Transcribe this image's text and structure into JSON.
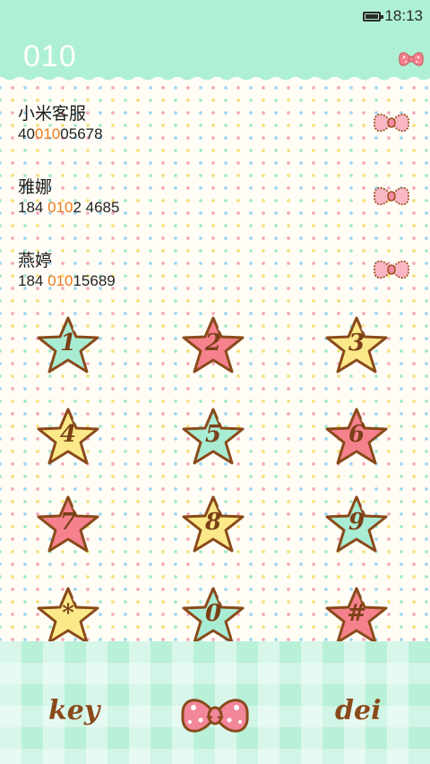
{
  "status_bar": {
    "time": "18:13",
    "battery_icon": "battery-icon"
  },
  "dialer": {
    "number": "010"
  },
  "contacts": [
    {
      "name": "小米客服",
      "phone_before": "40",
      "phone_match": "010",
      "phone_after": "05678"
    },
    {
      "name": "雅娜",
      "phone_before": "184 ",
      "phone_match": "010",
      "phone_after": "2 4685"
    },
    {
      "name": "燕婷",
      "phone_before": "184 ",
      "phone_match": "010",
      "phone_after": "15689"
    }
  ],
  "keypad": {
    "keys": [
      {
        "label": "1",
        "color": "#a8ecd3"
      },
      {
        "label": "2",
        "color": "#f5818d"
      },
      {
        "label": "3",
        "color": "#fbe989"
      },
      {
        "label": "4",
        "color": "#fbe989"
      },
      {
        "label": "5",
        "color": "#a8ecd3"
      },
      {
        "label": "6",
        "color": "#f5818d"
      },
      {
        "label": "7",
        "color": "#f5818d"
      },
      {
        "label": "8",
        "color": "#fbe989"
      },
      {
        "label": "9",
        "color": "#a8ecd3"
      },
      {
        "label": "*",
        "color": "#fbe989"
      },
      {
        "label": "0",
        "color": "#a8ecd3"
      },
      {
        "label": "#",
        "color": "#f5818d"
      }
    ]
  },
  "bottom_bar": {
    "left_label": "key",
    "right_label": "dei",
    "center_icon": "bow-icon"
  },
  "colors": {
    "header": "#aef0d4",
    "highlight": "#f07a1a",
    "star_outline": "#8a4a1a"
  }
}
